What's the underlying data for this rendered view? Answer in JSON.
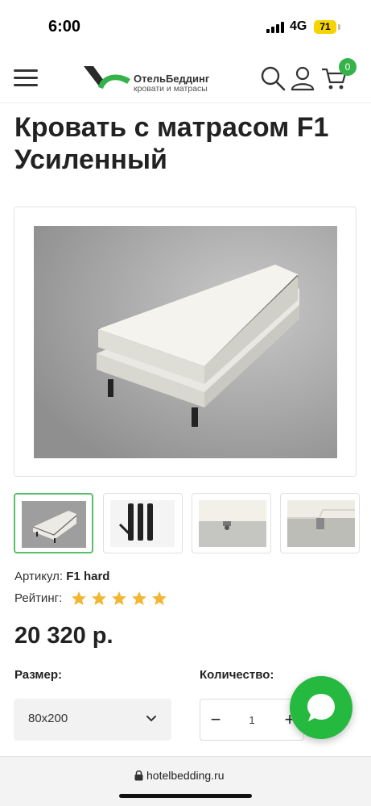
{
  "status_bar": {
    "time": "6:00",
    "network": "4G",
    "battery": "71"
  },
  "header": {
    "logo_name": "ОтельБеддинг",
    "logo_tagline": "кровати и матрасы",
    "cart_count": "0",
    "icons": [
      "menu-icon",
      "search-icon",
      "user-icon",
      "cart-icon"
    ]
  },
  "product": {
    "title": "Кровать с матрасом F1 Усиленный",
    "sku_label": "Артикул:",
    "sku_value": "F1 hard",
    "rating_label": "Рейтинг:",
    "rating": 5,
    "rating_max": 5,
    "price": "20 320 р.",
    "size_label": "Размер:",
    "size_value": "80x200",
    "quantity_label": "Количество:",
    "quantity": "1",
    "minus": "−",
    "plus": "+"
  },
  "gallery": {
    "thumbnails": [
      "bed-with-mattress",
      "bed-legs",
      "bed-base-corner",
      "bed-base-leg"
    ],
    "active_index": 0
  },
  "browser": {
    "url": "hotelbedding.ru"
  },
  "colors": {
    "accent": "#35b34a",
    "star": "#f2b632",
    "chat": "#25b93f"
  }
}
